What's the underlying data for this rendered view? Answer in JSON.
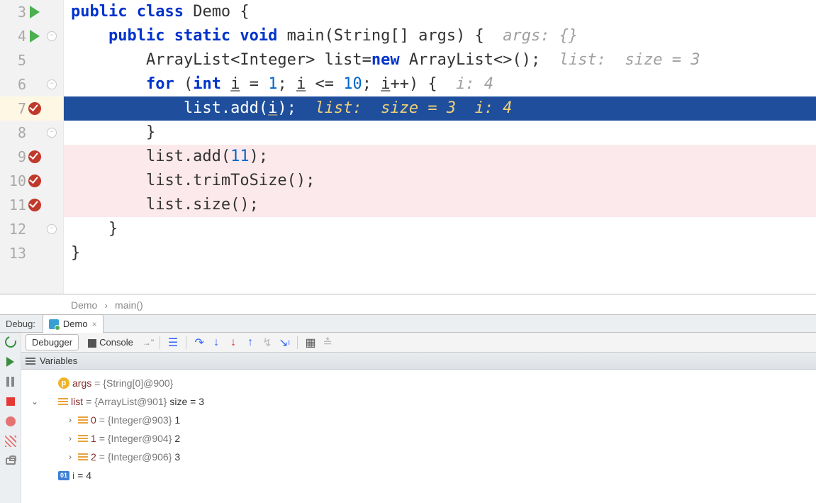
{
  "editor": {
    "lines": [
      {
        "n": "3"
      },
      {
        "n": "4"
      },
      {
        "n": "5"
      },
      {
        "n": "6"
      },
      {
        "n": "7"
      },
      {
        "n": "8"
      },
      {
        "n": "9"
      },
      {
        "n": "10"
      },
      {
        "n": "11"
      },
      {
        "n": "12"
      },
      {
        "n": "13"
      }
    ],
    "code": {
      "l3_kw": "public class",
      "l3_rest": " Demo {",
      "l4_kw": "public static void",
      "l4_rest": " main(String[] args) {  ",
      "l4_inline": "args: {}",
      "l5_a": "        ArrayList<Integer> list=",
      "l5_kw": "new",
      "l5_b": " ArrayList<>();  ",
      "l5_inline": "list:  size = 3",
      "l6_kw1": "for",
      "l6_a": " (",
      "l6_kw2": "int",
      "l6_b": " ",
      "l6_i": "i",
      "l6_c": " = ",
      "l6_n1": "1",
      "l6_d": "; ",
      "l6_i2": "i",
      "l6_e": " <= ",
      "l6_n2": "10",
      "l6_f": "; ",
      "l6_i3": "i",
      "l6_g": "++) {  ",
      "l6_inline": "i: 4",
      "l7_a": "            list.add(",
      "l7_i": "i",
      "l7_b": ");  ",
      "l7_inline1": "list:  size = 3",
      "l7_inline2": "  i: 4",
      "l8": "        }",
      "l9_a": "        list.add(",
      "l9_n": "11",
      "l9_b": ");",
      "l10": "        list.trimToSize();",
      "l11": "        list.size();",
      "l12": "    }",
      "l13": "}"
    }
  },
  "crumb": {
    "a": "Demo",
    "sep": "›",
    "b": "main()"
  },
  "debug": {
    "title": "Debug:",
    "tab": "Demo",
    "debugger_tab": "Debugger",
    "console_tab": "Console",
    "settings_glyph": "→\"",
    "vars_header": "Variables",
    "vars": {
      "args": {
        "name": "args",
        "val": " = {String[0]@900} "
      },
      "list": {
        "name": "list",
        "val": " = {ArrayList@901} ",
        "trail": "size = 3"
      },
      "e0": {
        "name": "0",
        "val": " = {Integer@903} ",
        "trail": "1"
      },
      "e1": {
        "name": "1",
        "val": " = {Integer@904} ",
        "trail": "2"
      },
      "e2": {
        "name": "2",
        "val": " = {Integer@906} ",
        "trail": "3"
      },
      "i": {
        "name": "i",
        "trail": " = 4"
      }
    }
  }
}
